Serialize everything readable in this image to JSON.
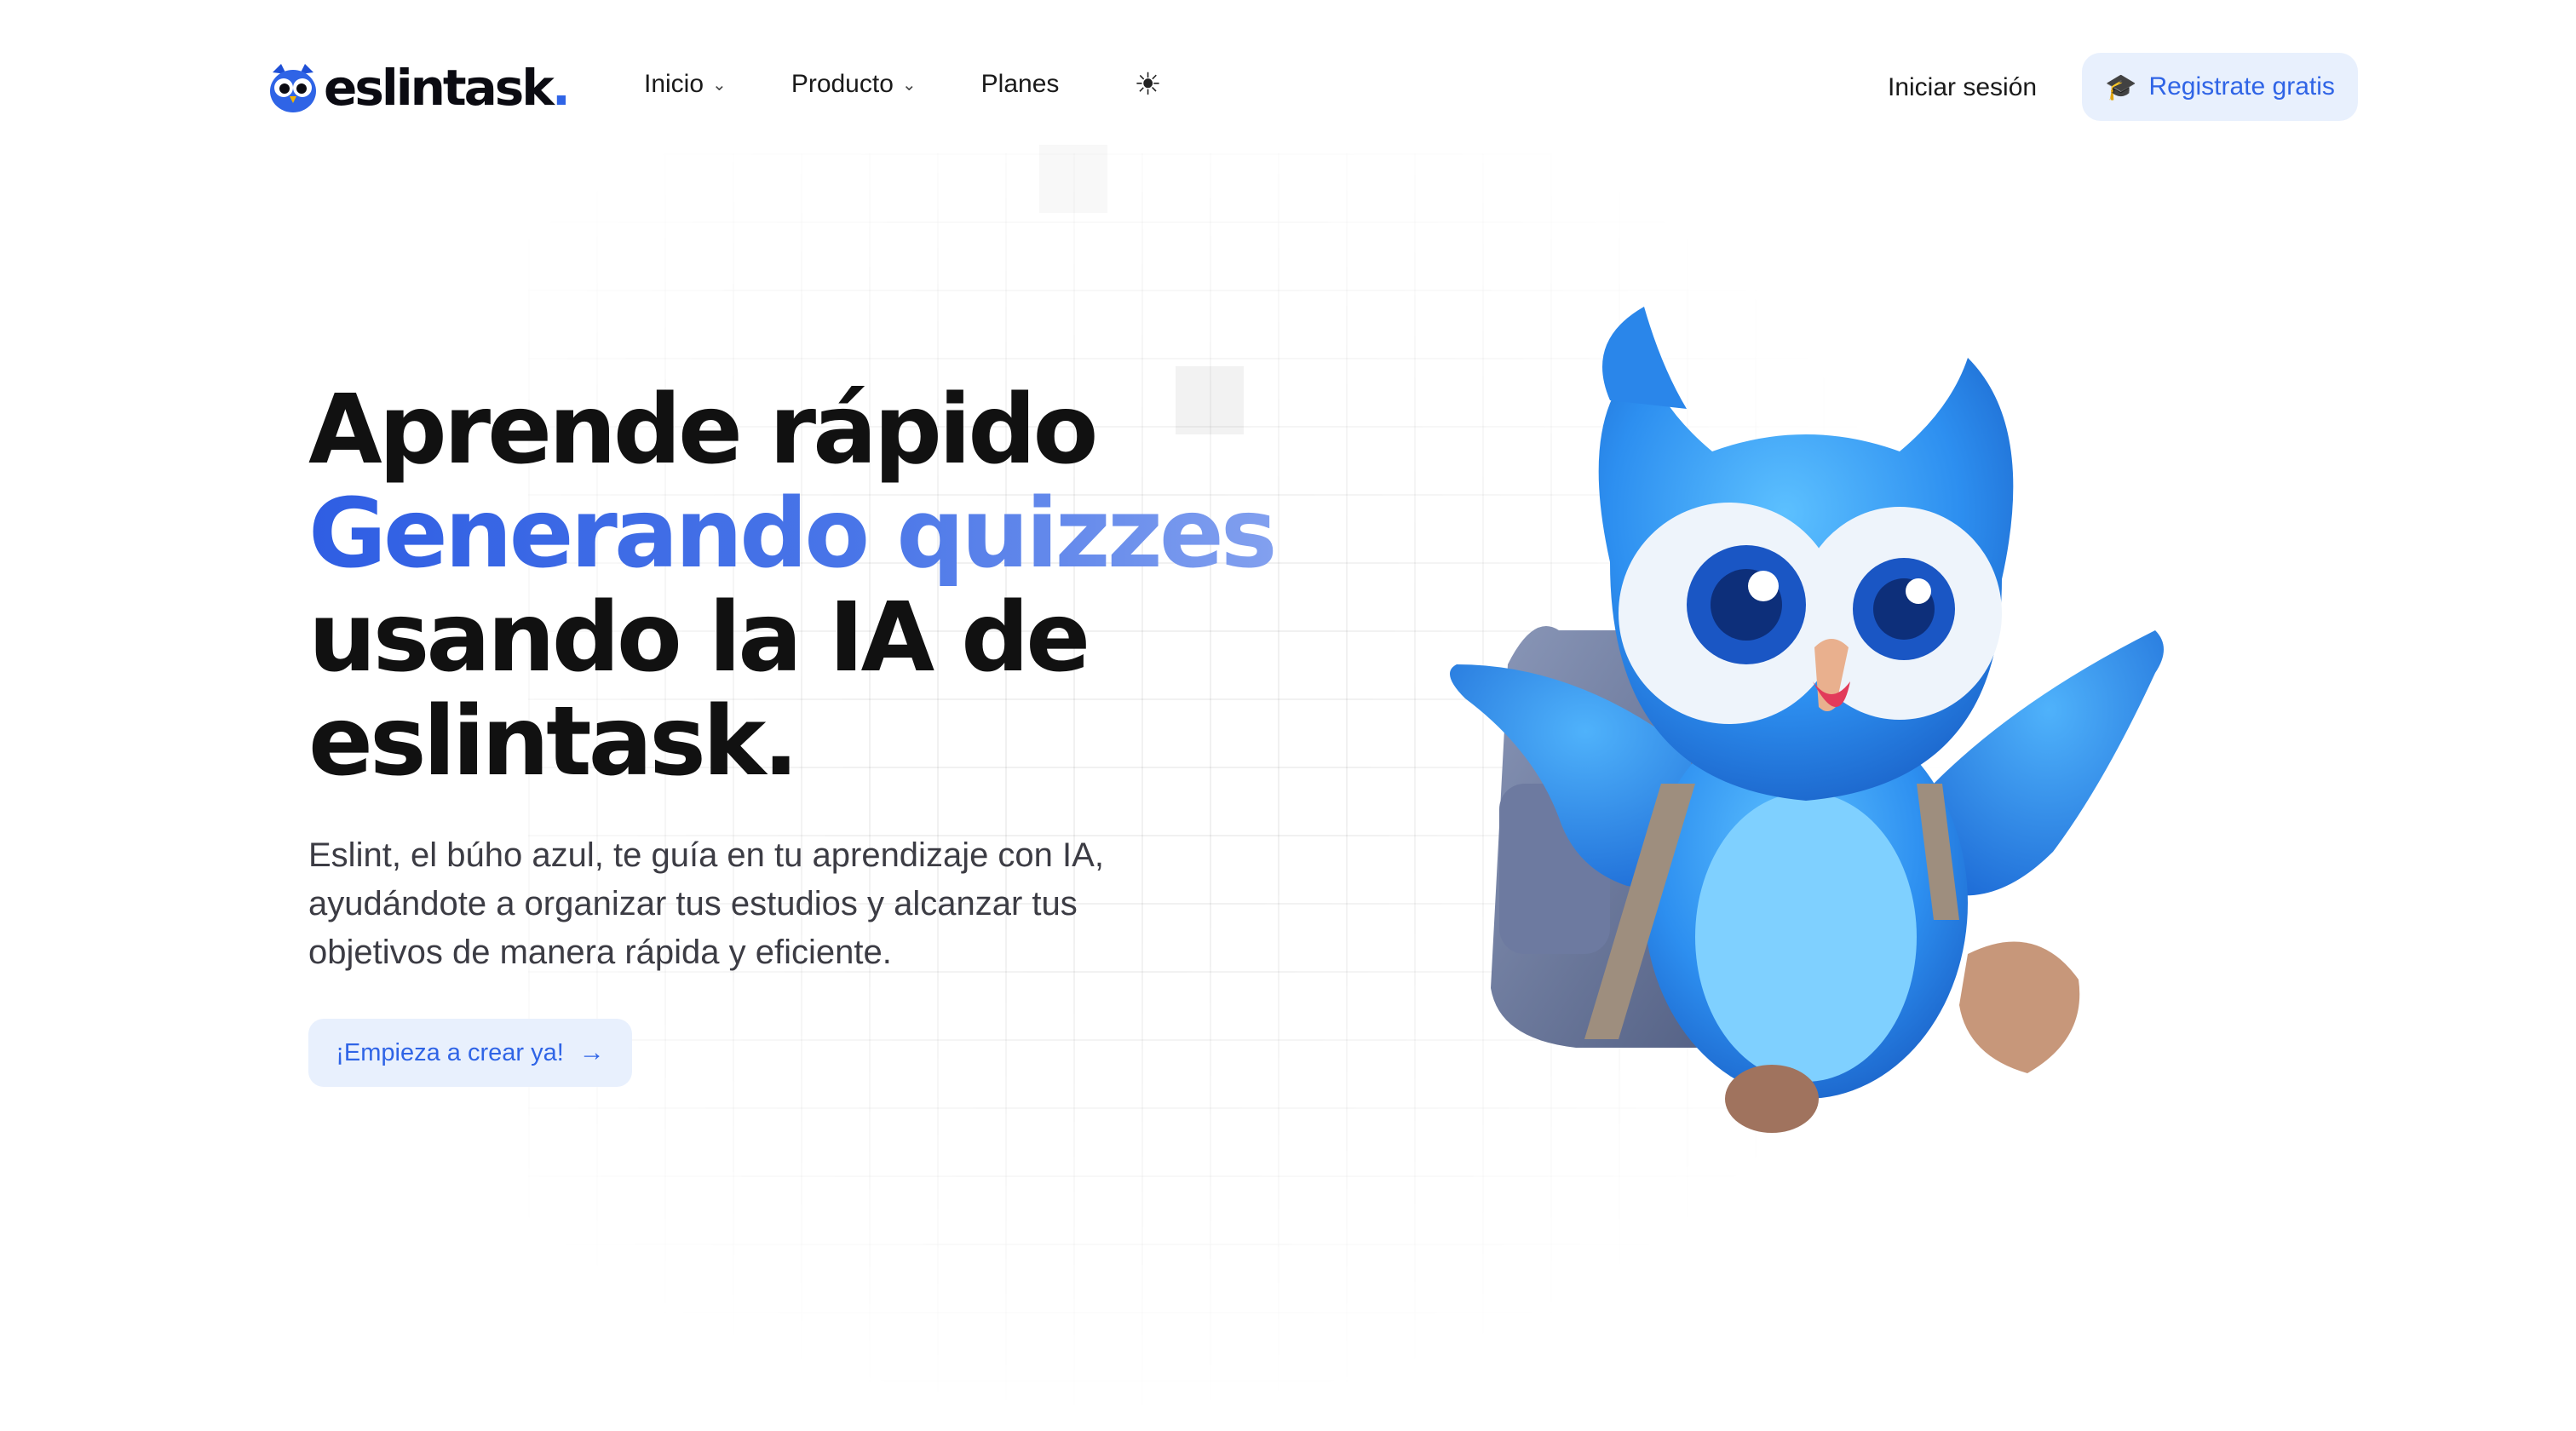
{
  "brand": {
    "name": "eslintask",
    "dot": ".",
    "accent": "#2f64e6"
  },
  "nav": {
    "items": [
      {
        "label": "Inicio",
        "has_dropdown": true
      },
      {
        "label": "Producto",
        "has_dropdown": true
      },
      {
        "label": "Planes",
        "has_dropdown": false
      }
    ],
    "theme_icon": "sun-icon"
  },
  "header_actions": {
    "login_label": "Iniciar sesión",
    "register_label": "Registrate gratis",
    "register_icon": "graduation-cap-icon"
  },
  "hero": {
    "line1": "Aprende rápido",
    "line2": "Generando quizzes",
    "line3": "usando la IA de",
    "line4": "eslintask.",
    "description": "Eslint, el búho azul, te guía en tu aprendizaje con IA, ayudándote a organizar tus estudios y alcanzar tus objetivos de manera rápida y eficiente.",
    "cta_label": "¡Empieza a crear ya!",
    "cta_icon": "arrow-right-icon"
  },
  "colors": {
    "primary": "#2f64e6",
    "button_bg": "#e8f0fd",
    "owl_blue": "#2d8ff0",
    "text_dark": "#111111"
  }
}
